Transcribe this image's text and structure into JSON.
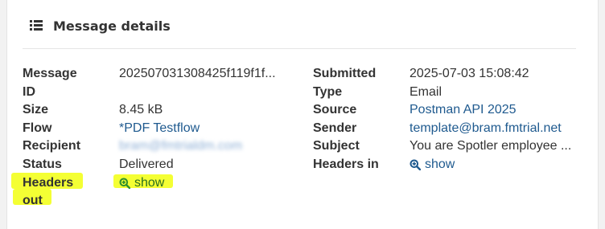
{
  "panel": {
    "title": "Message details",
    "icon": "list-icon"
  },
  "left": {
    "message_id_label_1": "Message",
    "message_id_label_2": "ID",
    "message_id_value": "202507031308425f119f1f...",
    "size_label": "Size",
    "size_value": "8.45 kB",
    "flow_label": "Flow",
    "flow_value": "*PDF Testflow",
    "recipient_label": "Recipient",
    "recipient_value": "bram@fmtrialdm.com",
    "status_label": "Status",
    "status_value": "Delivered",
    "headers_out_label_1": "Headers",
    "headers_out_label_2": "out",
    "headers_out_link": "show"
  },
  "right": {
    "submitted_label": "Submitted",
    "submitted_value": "2025-07-03 15:08:42",
    "type_label": "Type",
    "type_value": "Email",
    "source_label": "Source",
    "source_value": "Postman API 2025",
    "sender_label": "Sender",
    "sender_value": "template@bram.fmtrial.net",
    "subject_label": "Subject",
    "subject_value": "You are Spotler employee ...",
    "headers_in_label": "Headers in",
    "headers_in_link": "show"
  },
  "colors": {
    "link": "#1f5a8f",
    "highlight": "#f3ff1e",
    "icon_green": "#2f8f2f"
  }
}
